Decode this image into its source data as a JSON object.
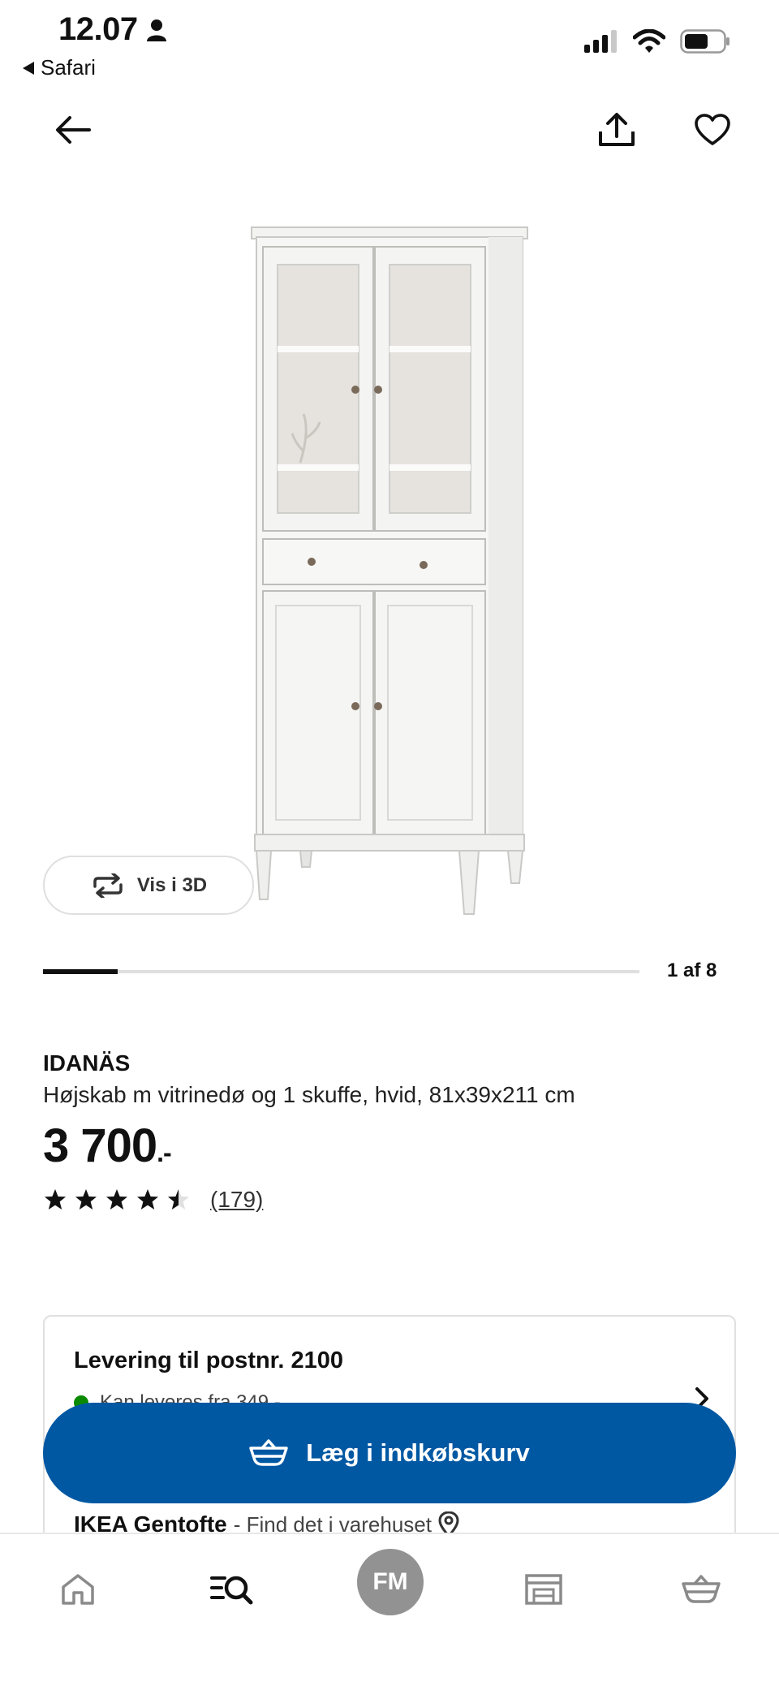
{
  "status_bar": {
    "time": "12.07",
    "back_app": "Safari"
  },
  "product": {
    "brand": "IDANÄS",
    "description": "Højskab m vitrinedø og 1 skuffe, hvid, 81x39x211 cm",
    "price": "3 700",
    "price_suffix": ".-",
    "rating_stars": 4.5,
    "rating_max": 5,
    "review_count": "(179)"
  },
  "gallery": {
    "view_3d_label": "Vis i 3D",
    "position_label": "1 af 8",
    "current": 1,
    "total": 8
  },
  "delivery": {
    "title": "Levering til postnr. 2100",
    "subtitle": "Kan leveres fra 349,-",
    "store_name": "IKEA Gentofte",
    "store_text": "- Find det i varehuset"
  },
  "cart_button": {
    "label": "Læg i indkøbskurv"
  },
  "bottom_nav": {
    "avatar_initials": "FM"
  },
  "colors": {
    "primary_blue": "#0058a3",
    "available_green": "#0a8a00",
    "avatar_gray": "#929292"
  }
}
